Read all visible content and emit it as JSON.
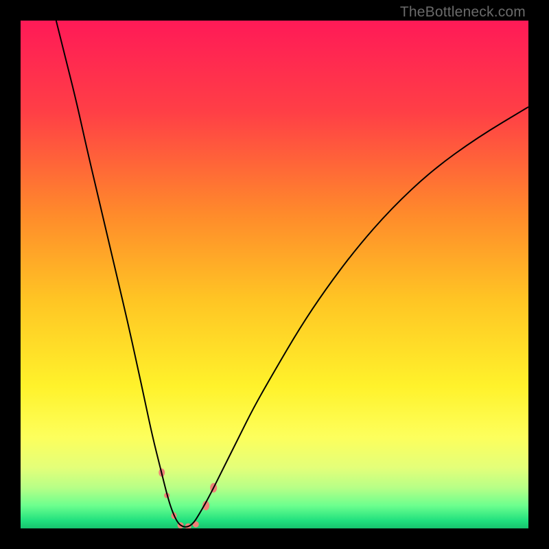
{
  "watermark": {
    "text": "TheBottleneck.com"
  },
  "chart_data": {
    "type": "line",
    "title": "",
    "xlabel": "",
    "ylabel": "",
    "xlim": [
      0,
      100
    ],
    "ylim": [
      0,
      100
    ],
    "grid": false,
    "legend": false,
    "background_gradient_stops": [
      {
        "offset": 0.0,
        "color": "#ff1a57"
      },
      {
        "offset": 0.18,
        "color": "#ff3f46"
      },
      {
        "offset": 0.38,
        "color": "#ff8a2b"
      },
      {
        "offset": 0.55,
        "color": "#ffc524"
      },
      {
        "offset": 0.72,
        "color": "#fff22b"
      },
      {
        "offset": 0.82,
        "color": "#fdff5c"
      },
      {
        "offset": 0.88,
        "color": "#e4ff79"
      },
      {
        "offset": 0.92,
        "color": "#b7ff87"
      },
      {
        "offset": 0.955,
        "color": "#6cff8e"
      },
      {
        "offset": 0.985,
        "color": "#20e07e"
      },
      {
        "offset": 1.0,
        "color": "#17c36e"
      }
    ],
    "series": [
      {
        "name": "bottleneck-curve",
        "color": "#000000",
        "stroke_width": 2.0,
        "x": [
          7.0,
          9.0,
          11.0,
          13.0,
          15.0,
          17.0,
          19.0,
          21.0,
          23.0,
          24.5,
          26.0,
          27.5,
          29.0,
          30.0,
          31.0,
          32.0,
          33.0,
          34.0,
          35.0,
          37.0,
          40.0,
          43.0,
          46.0,
          50.0,
          55.0,
          60.0,
          66.0,
          73.0,
          81.0,
          90.0,
          100.0
        ],
        "y": [
          100.0,
          92.0,
          84.0,
          75.0,
          66.5,
          58.0,
          49.5,
          41.0,
          32.0,
          25.0,
          18.0,
          12.0,
          6.0,
          3.0,
          1.0,
          0.3,
          0.3,
          1.0,
          2.5,
          6.0,
          12.0,
          18.0,
          24.0,
          31.0,
          39.5,
          47.0,
          55.0,
          63.0,
          70.5,
          77.0,
          83.0
        ]
      }
    ],
    "markers": [
      {
        "name": "left-upper-marker",
        "x": 27.8,
        "y": 11.0,
        "rx": 4.5,
        "ry": 6.0,
        "color": "#ee8277"
      },
      {
        "name": "left-mid-marker",
        "x": 28.8,
        "y": 6.5,
        "rx": 4.0,
        "ry": 4.0,
        "color": "#ee8277"
      },
      {
        "name": "left-low-marker",
        "x": 30.2,
        "y": 2.5,
        "rx": 4.0,
        "ry": 5.0,
        "color": "#ee8277"
      },
      {
        "name": "trough-left-marker",
        "x": 31.5,
        "y": 0.6,
        "rx": 4.5,
        "ry": 4.5,
        "color": "#ee8277"
      },
      {
        "name": "trough-mid-marker",
        "x": 33.0,
        "y": 0.4,
        "rx": 4.5,
        "ry": 4.5,
        "color": "#ee8277"
      },
      {
        "name": "trough-right-marker",
        "x": 34.5,
        "y": 0.8,
        "rx": 4.5,
        "ry": 4.5,
        "color": "#ee8277"
      },
      {
        "name": "right-low-marker",
        "x": 36.5,
        "y": 4.5,
        "rx": 5.0,
        "ry": 7.0,
        "color": "#ee8277"
      },
      {
        "name": "right-mid-marker",
        "x": 38.0,
        "y": 8.0,
        "rx": 5.0,
        "ry": 7.0,
        "color": "#ee8277"
      }
    ]
  }
}
